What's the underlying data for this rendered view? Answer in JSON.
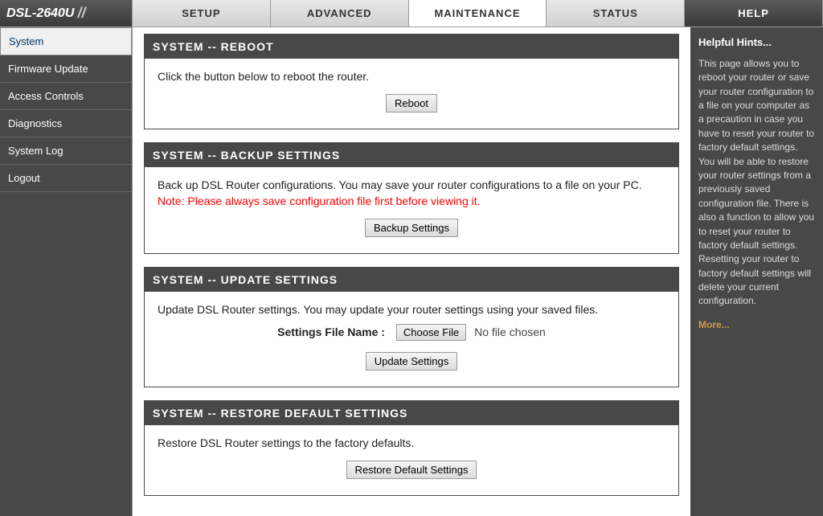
{
  "logo": "DSL-2640U",
  "tabs": {
    "setup": "SETUP",
    "advanced": "ADVANCED",
    "maintenance": "MAINTENANCE",
    "status": "STATUS",
    "help": "HELP"
  },
  "sidebar": {
    "items": [
      {
        "label": "System"
      },
      {
        "label": "Firmware Update"
      },
      {
        "label": "Access Controls"
      },
      {
        "label": "Diagnostics"
      },
      {
        "label": "System Log"
      },
      {
        "label": "Logout"
      }
    ]
  },
  "panels": {
    "reboot": {
      "title": "SYSTEM -- REBOOT",
      "text": "Click the button below to reboot the router.",
      "button": "Reboot"
    },
    "backup": {
      "title": "SYSTEM -- BACKUP SETTINGS",
      "text": "Back up DSL Router configurations. You may save your router configurations to a file on your PC.",
      "note": "Note: Please always save configuration file first before viewing it.",
      "button": "Backup Settings"
    },
    "update": {
      "title": "SYSTEM -- UPDATE SETTINGS",
      "text": "Update DSL Router settings. You may update your router settings using your saved files.",
      "file_label": "Settings File Name :",
      "choose_file": "Choose File",
      "no_file": "No file chosen",
      "button": "Update Settings"
    },
    "restore": {
      "title": "SYSTEM -- RESTORE DEFAULT SETTINGS",
      "text": "Restore DSL Router settings to the factory defaults.",
      "button": "Restore Default Settings"
    }
  },
  "help": {
    "title": "Helpful Hints...",
    "body": "This page allows you to reboot your router or save your router configuration to a file on your computer as a precaution in case you have to reset your router to factory default settings. You will be able to restore your router settings from a previously saved configuration file. There is also a function to allow you to reset your router to factory default settings. Resetting your router to factory default settings will delete your current configuration.",
    "more": "More..."
  }
}
